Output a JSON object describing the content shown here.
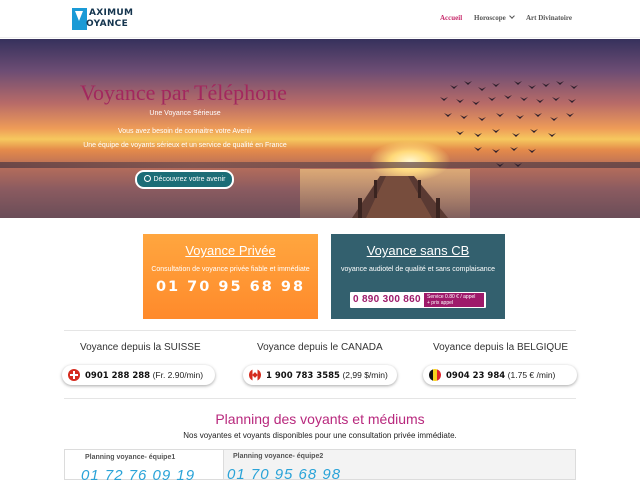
{
  "header": {
    "logo_line1": "AXIMUM",
    "logo_line2": "OYANCE",
    "nav": [
      {
        "label": "Accueil",
        "active": true
      },
      {
        "label": "Horoscope",
        "has_dropdown": true
      },
      {
        "label": "Art Divinatoire"
      }
    ]
  },
  "hero": {
    "title": "Voyance par Téléphone",
    "lines": [
      "Une Voyance Sérieuse",
      "Vous avez besoin de connaitre votre Avenir",
      "Une équipe de voyants sérieux et un service de qualité en France"
    ],
    "button_label": "Découvrez votre avenir"
  },
  "cards": {
    "private": {
      "title": "Voyance Privée",
      "description": "Consultation de voyance privée fiable et immédiate",
      "phone": "01 70 95 68 98"
    },
    "sans_cb": {
      "title": "Voyance sans CB",
      "description": "voyance audiotel de qualité et sans complaisance",
      "phone": "0 890 300 860",
      "rate_line1": "Service 0.80 € / appel",
      "rate_line2": "+ prix appel"
    }
  },
  "countries": [
    {
      "label": "Voyance depuis la SUISSE",
      "phone": "0901 288 288",
      "rate": "(Fr. 2.90/min)",
      "flag": "swiss-flag"
    },
    {
      "label": "Voyance depuis le CANADA",
      "phone": "1 900 783 3585",
      "rate": "(2,99 $/min)",
      "flag": "canada-flag"
    },
    {
      "label": "Voyance depuis la BELGIQUE",
      "phone": "0904 23 984",
      "rate": "(1.75 € /min)",
      "flag": "belgium-flag"
    }
  ],
  "planning": {
    "title": "Planning des voyants et médiums",
    "subtitle": "Nos voyantes et voyants disponibles pour une consultation privée immédiate.",
    "columns": [
      {
        "heading": "Planning voyance- équipe1",
        "phone": "01 72 76 09 19"
      },
      {
        "heading": "Planning voyance- équipe2",
        "phone": "01 70 95 68 98"
      }
    ]
  },
  "colors": {
    "accent_pink": "#c7296a",
    "orange": "#ff8a2b",
    "teal_blue": "#33606e",
    "hero_button": "#1c6d77",
    "planning_phone": "#2aa3d8"
  }
}
